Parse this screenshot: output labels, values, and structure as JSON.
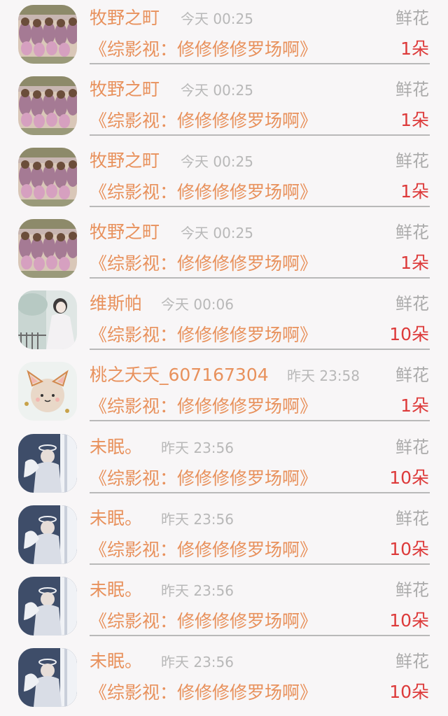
{
  "rows": [
    {
      "name": "牧野之町",
      "time": "今天 00:25",
      "gift": "鲜花",
      "work": "《综影视：修修修修罗场啊》",
      "count": "1朵",
      "avatar": "crowd"
    },
    {
      "name": "牧野之町",
      "time": "今天 00:25",
      "gift": "鲜花",
      "work": "《综影视：修修修修罗场啊》",
      "count": "1朵",
      "avatar": "crowd"
    },
    {
      "name": "牧野之町",
      "time": "今天 00:25",
      "gift": "鲜花",
      "work": "《综影视：修修修修罗场啊》",
      "count": "1朵",
      "avatar": "crowd"
    },
    {
      "name": "牧野之町",
      "time": "今天 00:25",
      "gift": "鲜花",
      "work": "《综影视：修修修修罗场啊》",
      "count": "1朵",
      "avatar": "crowd"
    },
    {
      "name": "维斯帕",
      "time": "今天 00:06",
      "gift": "鲜花",
      "work": "《综影视：修修修修罗场啊》",
      "count": "10朵",
      "avatar": "girl-white"
    },
    {
      "name": "桃之夭夭_607167304",
      "time": "昨天 23:58",
      "gift": "鲜花",
      "work": "《综影视：修修修修罗场啊》",
      "count": "1朵",
      "avatar": "cat"
    },
    {
      "name": "未眠。",
      "time": "昨天 23:56",
      "gift": "鲜花",
      "work": "《综影视：修修修修罗场啊》",
      "count": "10朵",
      "avatar": "angel"
    },
    {
      "name": "未眠。",
      "time": "昨天 23:56",
      "gift": "鲜花",
      "work": "《综影视：修修修修罗场啊》",
      "count": "10朵",
      "avatar": "angel"
    },
    {
      "name": "未眠。",
      "time": "昨天 23:56",
      "gift": "鲜花",
      "work": "《综影视：修修修修罗场啊》",
      "count": "10朵",
      "avatar": "angel"
    },
    {
      "name": "未眠。",
      "time": "昨天 23:56",
      "gift": "鲜花",
      "work": "《综影视：修修修修罗场啊》",
      "count": "10朵",
      "avatar": "angel"
    }
  ],
  "colors": {
    "name": "#e8915c",
    "work": "#e8915c",
    "count": "#dd3a3a",
    "time": "#b8b8b8",
    "gift": "#ababab"
  }
}
